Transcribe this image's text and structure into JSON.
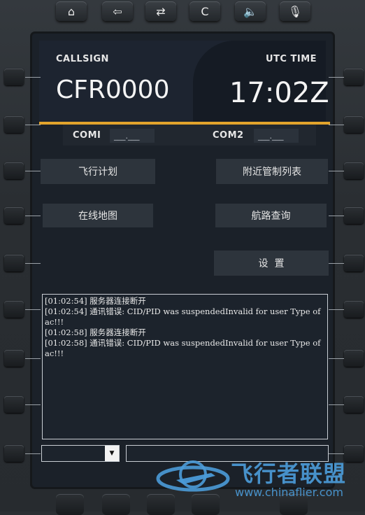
{
  "top_keys": [
    {
      "icon": "home-icon",
      "glyph": "⌂"
    },
    {
      "icon": "back-arrow-icon",
      "glyph": "⇦"
    },
    {
      "icon": "swap-icon",
      "glyph": "⇄"
    },
    {
      "icon": "clear-icon",
      "glyph": "C"
    },
    {
      "icon": "speaker-icon",
      "glyph": "🔈"
    },
    {
      "icon": "microphone-icon",
      "glyph": "🎙"
    }
  ],
  "header": {
    "callsign_label": "CALLSIGN",
    "callsign_value": "CFR0000",
    "utc_label": "UTC TIME",
    "utc_value": "17:02Z"
  },
  "com": {
    "com1_label": "COMI",
    "com1_value": "___.___",
    "com2_label": "COM2",
    "com2_value": "___.___"
  },
  "menu": {
    "flight_plan": "飞行计划",
    "nearby_atc": "附近管制列表",
    "online_map": "在线地图",
    "route_query": "航路查询",
    "settings": "设  置"
  },
  "log": {
    "lines": [
      "[01:02:54] 服务器连接断开",
      "[01:02:54] 通讯错误: CID/PID was suspendedInvalid for user Type of ac!!!",
      "[01:02:58] 服务器连接断开",
      "[01:02:58] 通讯错误: CID/PID was suspendedInvalid for user Type of ac!!!"
    ]
  },
  "input": {
    "select_value": "",
    "command_value": ""
  },
  "watermark": {
    "name": "飞行者联盟",
    "url": "www.chinaflier.com"
  },
  "colors": {
    "accent": "#e2a42c",
    "watermark": "#4b9bd8"
  }
}
